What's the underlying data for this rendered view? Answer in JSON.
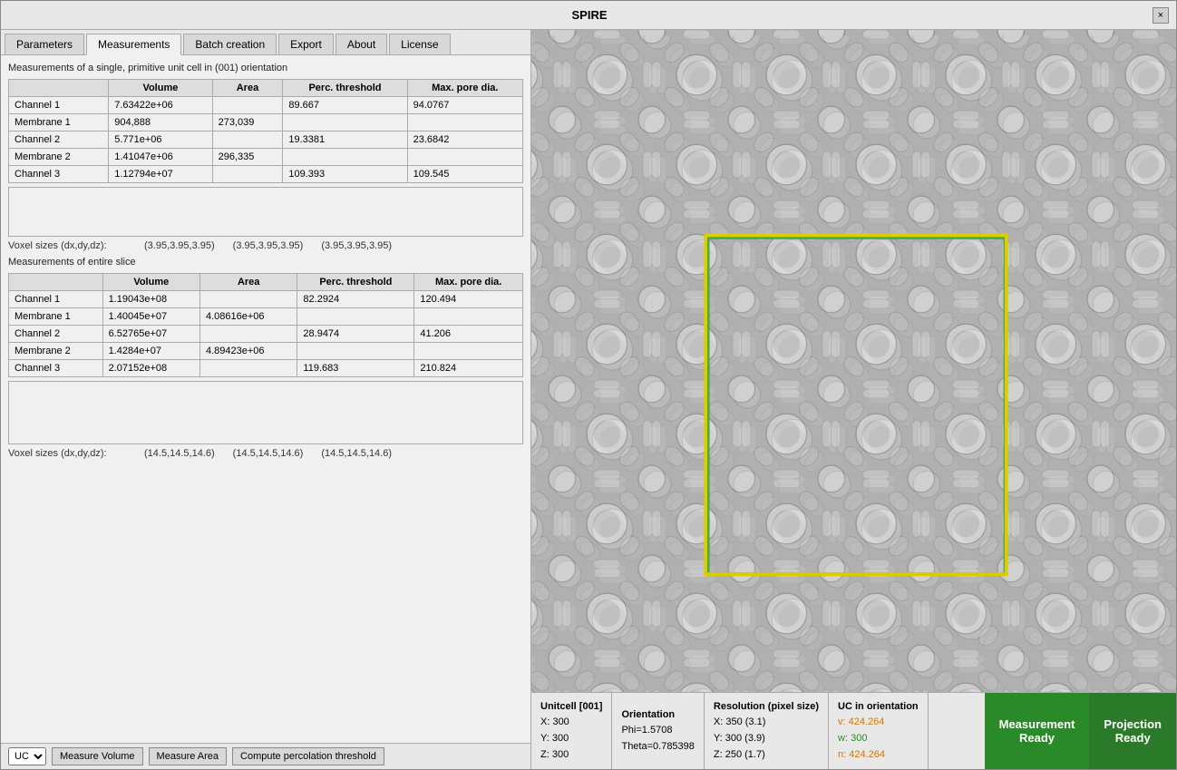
{
  "window": {
    "title": "SPIRE",
    "close_label": "×"
  },
  "tabs": [
    {
      "label": "Parameters",
      "active": false
    },
    {
      "label": "Measurements",
      "active": true
    },
    {
      "label": "Batch creation",
      "active": false
    },
    {
      "label": "Export",
      "active": false
    },
    {
      "label": "About",
      "active": false
    },
    {
      "label": "License",
      "active": false
    }
  ],
  "measurements": {
    "section1_title": "Measurements of a single, primitive unit cell in (001) orientation",
    "table1_headers": [
      "",
      "Volume",
      "Area",
      "Perc. threshold",
      "Max. pore dia."
    ],
    "table1_rows": [
      [
        "Channel 1",
        "7.63422e+06",
        "",
        "89.667",
        "94.0767"
      ],
      [
        "Membrane 1",
        "904,888",
        "273,039",
        "",
        ""
      ],
      [
        "Channel 2",
        "5.771e+06",
        "",
        "19.3381",
        "23.6842"
      ],
      [
        "Membrane 2",
        "1.41047e+06",
        "296,335",
        "",
        ""
      ],
      [
        "Channel 3",
        "1.12794e+07",
        "",
        "109.393",
        "109.545"
      ]
    ],
    "voxel_label1": "Voxel sizes (dx,dy,dz):",
    "voxel_values1": [
      "(3.95,3.95,3.95)",
      "(3.95,3.95,3.95)",
      "(3.95,3.95,3.95)"
    ],
    "section2_title": "Measurements of entire slice",
    "table2_headers": [
      "",
      "Volume",
      "Area",
      "Perc. threshold",
      "Max. pore dia."
    ],
    "table2_rows": [
      [
        "Channel 1",
        "1.19043e+08",
        "",
        "82.2924",
        "120.494"
      ],
      [
        "Membrane 1",
        "1.40045e+07",
        "4.08616e+06",
        "",
        ""
      ],
      [
        "Channel 2",
        "6.52765e+07",
        "",
        "28.9474",
        "41.206"
      ],
      [
        "Membrane 2",
        "1.4284e+07",
        "4.89423e+06",
        "",
        ""
      ],
      [
        "Channel 3",
        "2.07152e+08",
        "",
        "119.683",
        "210.824"
      ]
    ],
    "voxel_label2": "Voxel sizes (dx,dy,dz):",
    "voxel_values2": [
      "(14.5,14.5,14.6)",
      "(14.5,14.5,14.6)",
      "(14.5,14.5,14.6)"
    ]
  },
  "bottom_toolbar": {
    "dropdown_value": "UC",
    "btn1": "Measure Volume",
    "btn2": "Measure Area",
    "btn3": "Compute percolation threshold"
  },
  "status_bar": {
    "unitcell_label": "Unitcell [001]",
    "unitcell_x": "X: 300",
    "unitcell_y": "Y: 300",
    "unitcell_z": "Z: 300",
    "orientation_label": "Orientation",
    "phi": "Phi=1.5708",
    "theta": "Theta=0.785398",
    "resolution_label": "Resolution (pixel size)",
    "res_x": "X:  350 (3.1)",
    "res_y": "Y:  300 (3.9)",
    "res_z": "Z:  250 (1.7)",
    "uc_orientation_label": "UC in orientation",
    "uc_v": "v: 424.264",
    "uc_w": "w: 300",
    "uc_n": "n: 424.264",
    "measurement_ready_line1": "Measurement",
    "measurement_ready_line2": "Ready",
    "projection_ready_line1": "Projection",
    "projection_ready_line2": "Ready"
  }
}
